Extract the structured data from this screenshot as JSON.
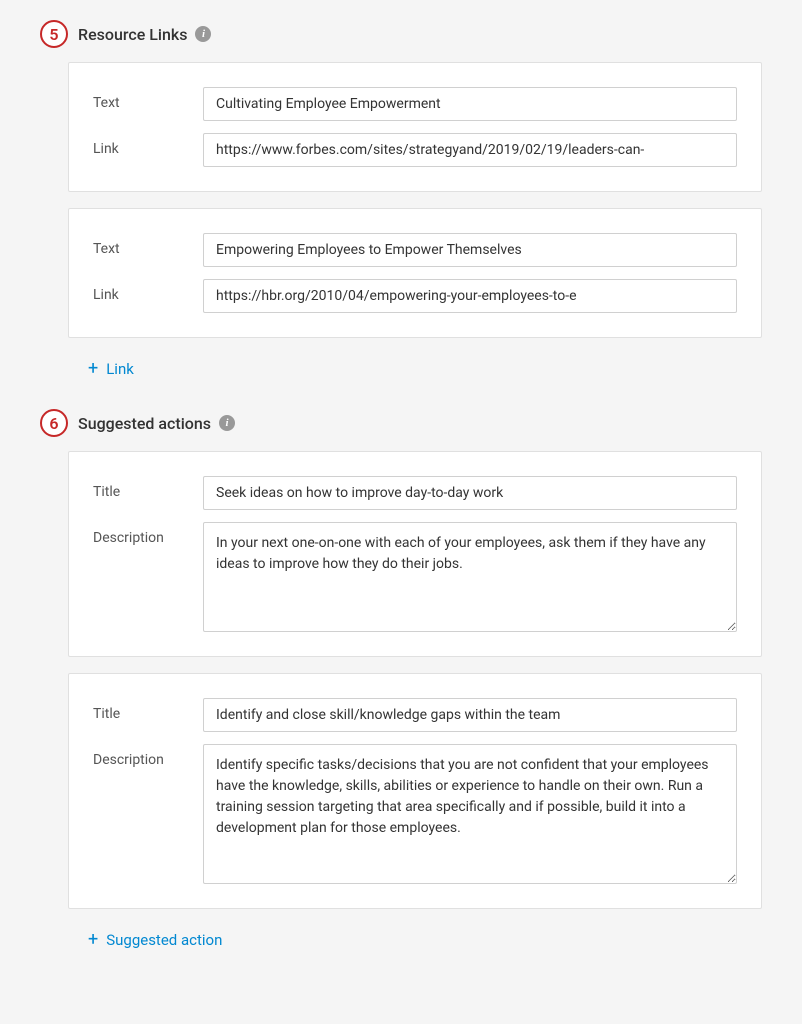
{
  "sections": {
    "resource_links": {
      "step_number": "5",
      "title": "Resource Links",
      "labels": {
        "text": "Text",
        "link": "Link"
      },
      "items": [
        {
          "text": "Cultivating Employee Empowerment",
          "link": "https://www.forbes.com/sites/strategyand/2019/02/19/leaders-can-"
        },
        {
          "text": "Empowering Employees to Empower Themselves",
          "link": "https://hbr.org/2010/04/empowering-your-employees-to-e"
        }
      ],
      "add_button": "Link"
    },
    "suggested_actions": {
      "step_number": "6",
      "title": "Suggested actions",
      "labels": {
        "title": "Title",
        "description": "Description"
      },
      "items": [
        {
          "title": "Seek ideas on how to improve day-to-day work",
          "description": "In your next one-on-one with each of your employees, ask them if they have any ideas to improve how they do their jobs."
        },
        {
          "title": "Identify and close skill/knowledge gaps within the team",
          "description": "Identify specific tasks/decisions that you are not confident that your employees have the knowledge, skills, abilities or experience to handle on their own. Run a training session targeting that area specifically and if possible, build it into a development plan for those employees."
        }
      ],
      "add_button": "Suggested action"
    }
  }
}
